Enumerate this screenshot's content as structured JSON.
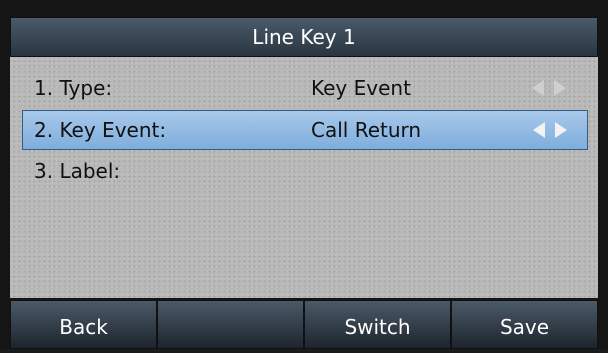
{
  "title": "Line Key 1",
  "rows": [
    {
      "label": "1. Type:",
      "value": "Key Event",
      "has_arrows": true,
      "selected": false
    },
    {
      "label": "2. Key Event:",
      "value": "Call Return",
      "has_arrows": true,
      "selected": true
    },
    {
      "label": "3. Label:",
      "value": "",
      "has_arrows": false,
      "selected": false
    }
  ],
  "icons": {
    "left_arrow": "triangle-left",
    "right_arrow": "triangle-right"
  },
  "softkeys": [
    {
      "label": "Back"
    },
    {
      "label": ""
    },
    {
      "label": "Switch"
    },
    {
      "label": "Save"
    }
  ],
  "colors": {
    "selection": "#8fb9e4",
    "title_bar": "#34414d",
    "softkey": "#2f3a44",
    "content_bg": "#b8b8b8"
  }
}
